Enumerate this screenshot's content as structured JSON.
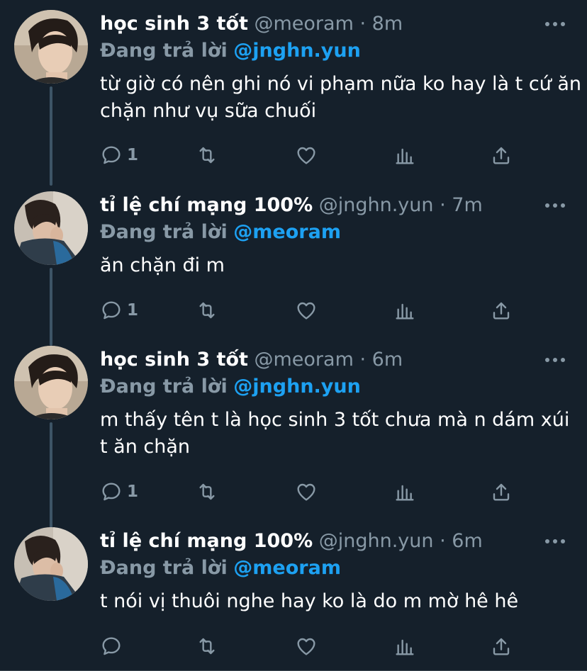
{
  "reply_prefix": "Đang trả lời",
  "tweets": [
    {
      "name": "học sinh 3 tốt",
      "handle": "@meoram",
      "separator": "·",
      "time": "8m",
      "reply_to": "@jnghn.yun",
      "text": "từ giờ có nên ghi nó vi phạm nữa ko hay là t cứ ăn chặn như vụ sữa chuối",
      "reply_count": "1"
    },
    {
      "name": "tỉ lệ chí mạng 100%",
      "handle": "@jnghn.yun",
      "separator": "·",
      "time": "7m",
      "reply_to": "@meoram",
      "text": "ăn chặn đi m",
      "reply_count": "1"
    },
    {
      "name": "học sinh 3 tốt",
      "handle": "@meoram",
      "separator": "·",
      "time": "6m",
      "reply_to": "@jnghn.yun",
      "text": "m thấy tên t là học sinh 3 tốt chưa mà n dám xúi t ăn chặn",
      "reply_count": "1"
    },
    {
      "name": "tỉ lệ chí mạng 100%",
      "handle": "@jnghn.yun",
      "separator": "·",
      "time": "6m",
      "reply_to": "@meoram",
      "text": "t nói vị thuôi nghe hay ko là do m mờ hê hê",
      "reply_count": ""
    }
  ],
  "colors": {
    "background": "#15202b",
    "text": "#ffffff",
    "secondary": "#8899a6",
    "link": "#1da1f2",
    "thread_line": "#3d5466"
  }
}
